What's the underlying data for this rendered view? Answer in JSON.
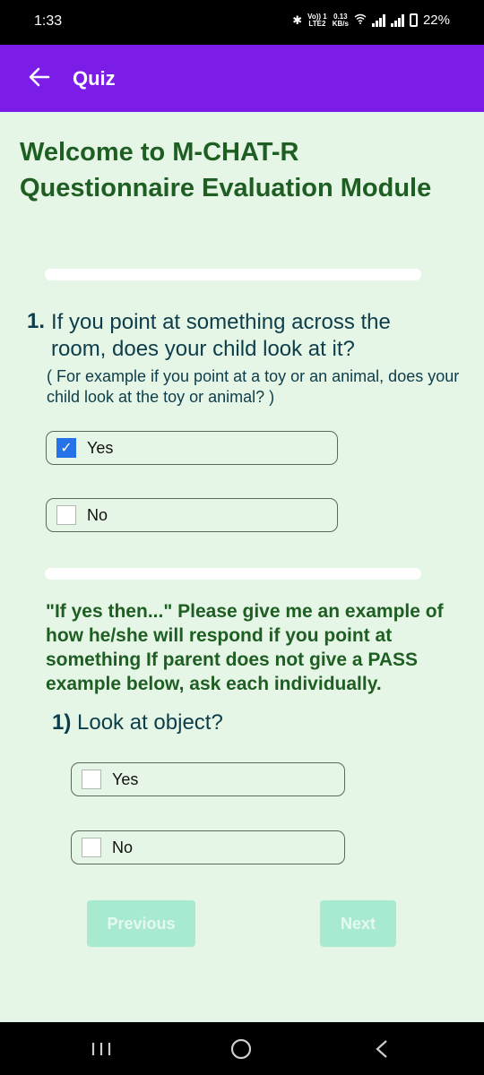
{
  "status_bar": {
    "time": "1:33",
    "network_top": "Vo)) 1",
    "network_bottom": "LTE2",
    "speed_top": "0.13",
    "speed_bottom": "KB/s",
    "battery": "22%"
  },
  "app_bar": {
    "title": "Quiz",
    "back_icon": "arrow-left-icon"
  },
  "welcome": "Welcome to M-CHAT-R Questionnaire Evaluation Module",
  "question": {
    "number": "1.",
    "text": "If you point at something across the room, does your child look at it?",
    "hint": "( For example if you point at a toy or an animal, does your child look at the toy or animal? )",
    "options": [
      {
        "label": "Yes",
        "checked": true
      },
      {
        "label": "No",
        "checked": false
      }
    ]
  },
  "followup": {
    "text": "\"If yes then...\" Please give me an example of how he/she will respond if you point at something If parent does not give a PASS example below, ask each individually.",
    "subquestion_number": "1)",
    "subquestion_text": "Look at object?",
    "options": [
      {
        "label": "Yes",
        "checked": false
      },
      {
        "label": "No",
        "checked": false
      }
    ]
  },
  "buttons": {
    "previous": "Previous",
    "next": "Next"
  },
  "colors": {
    "app_bar": "#7c1ce8",
    "heading_green": "#1e5e22",
    "button_disabled": "#a8ead0",
    "checkbox_blue": "#2672e8"
  }
}
